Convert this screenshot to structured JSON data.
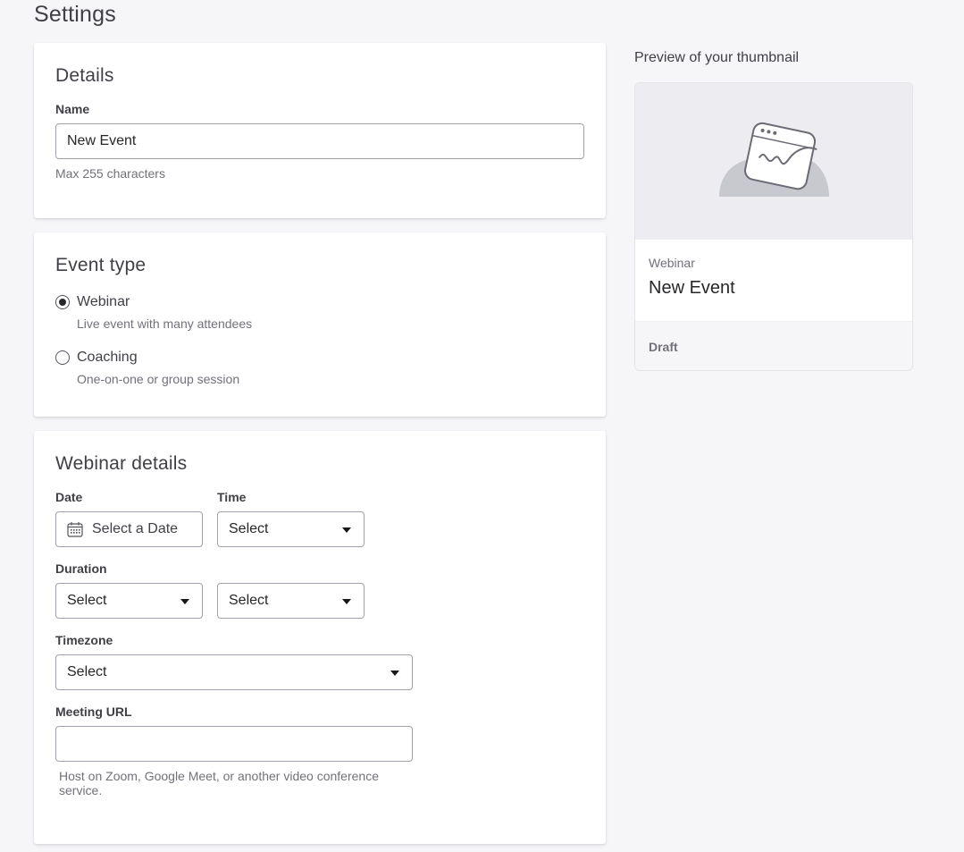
{
  "page": {
    "title": "Settings"
  },
  "details": {
    "heading": "Details",
    "name_label": "Name",
    "name_value": "New Event",
    "name_help": "Max 255 characters"
  },
  "event_type": {
    "heading": "Event type",
    "selected": "webinar",
    "options": [
      {
        "label": "Webinar",
        "description": "Live event with many attendees"
      },
      {
        "label": "Coaching",
        "description": "One-on-one or group session"
      }
    ]
  },
  "webinar_details": {
    "heading": "Webinar details",
    "date_label": "Date",
    "date_placeholder": "Select a Date",
    "time_label": "Time",
    "time_value": "Select",
    "duration_label": "Duration",
    "duration_value_1": "Select",
    "duration_value_2": "Select",
    "timezone_label": "Timezone",
    "timezone_value": "Select",
    "meeting_url_label": "Meeting URL",
    "meeting_url_value": "",
    "meeting_url_help": "Host on Zoom, Google Meet, or another video conference service."
  },
  "preview": {
    "title": "Preview of your thumbnail",
    "type": "Webinar",
    "name": "New Event",
    "status": "Draft",
    "illustration_icon": "image-placeholder-icon"
  },
  "colors": {
    "page_background": "#f6f6f9",
    "card_background": "#ffffff",
    "input_border": "#a1a1aa",
    "muted_text": "#71717a"
  }
}
